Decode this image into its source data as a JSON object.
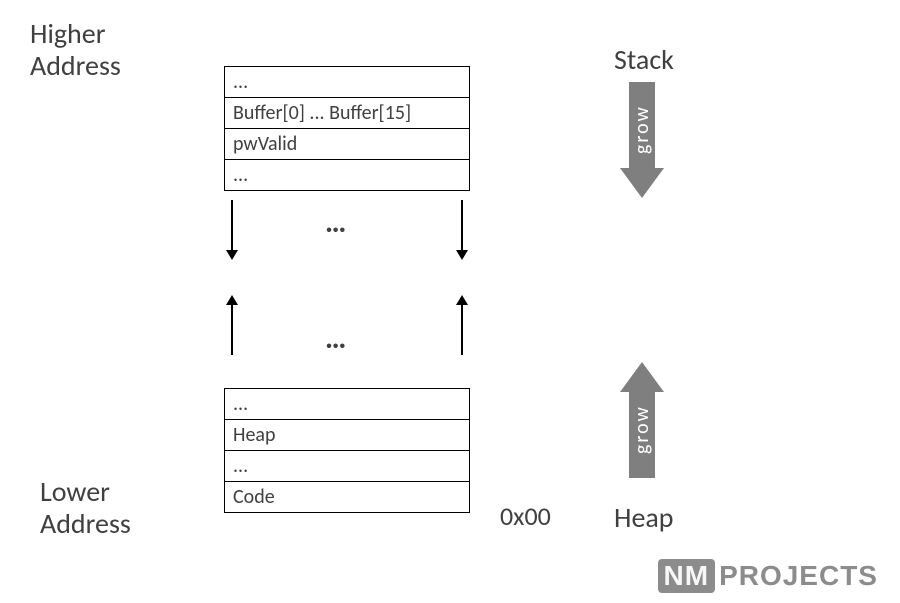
{
  "labels": {
    "higher_address": "Higher\nAddress",
    "lower_address": "Lower\nAddress",
    "stack": "Stack",
    "heap": "Heap",
    "grow_down": "grow",
    "grow_up": "grow",
    "addr0": "0x00",
    "dots_mid1": "…",
    "dots_mid2": "…"
  },
  "stack_rows": [
    "...",
    "Buffer[0] ... Buffer[15]",
    "pwValid",
    "..."
  ],
  "heap_rows": [
    "...",
    "Heap",
    "...",
    "Code"
  ],
  "logo": {
    "nm": "NM",
    "rest": "PROJECTS"
  }
}
